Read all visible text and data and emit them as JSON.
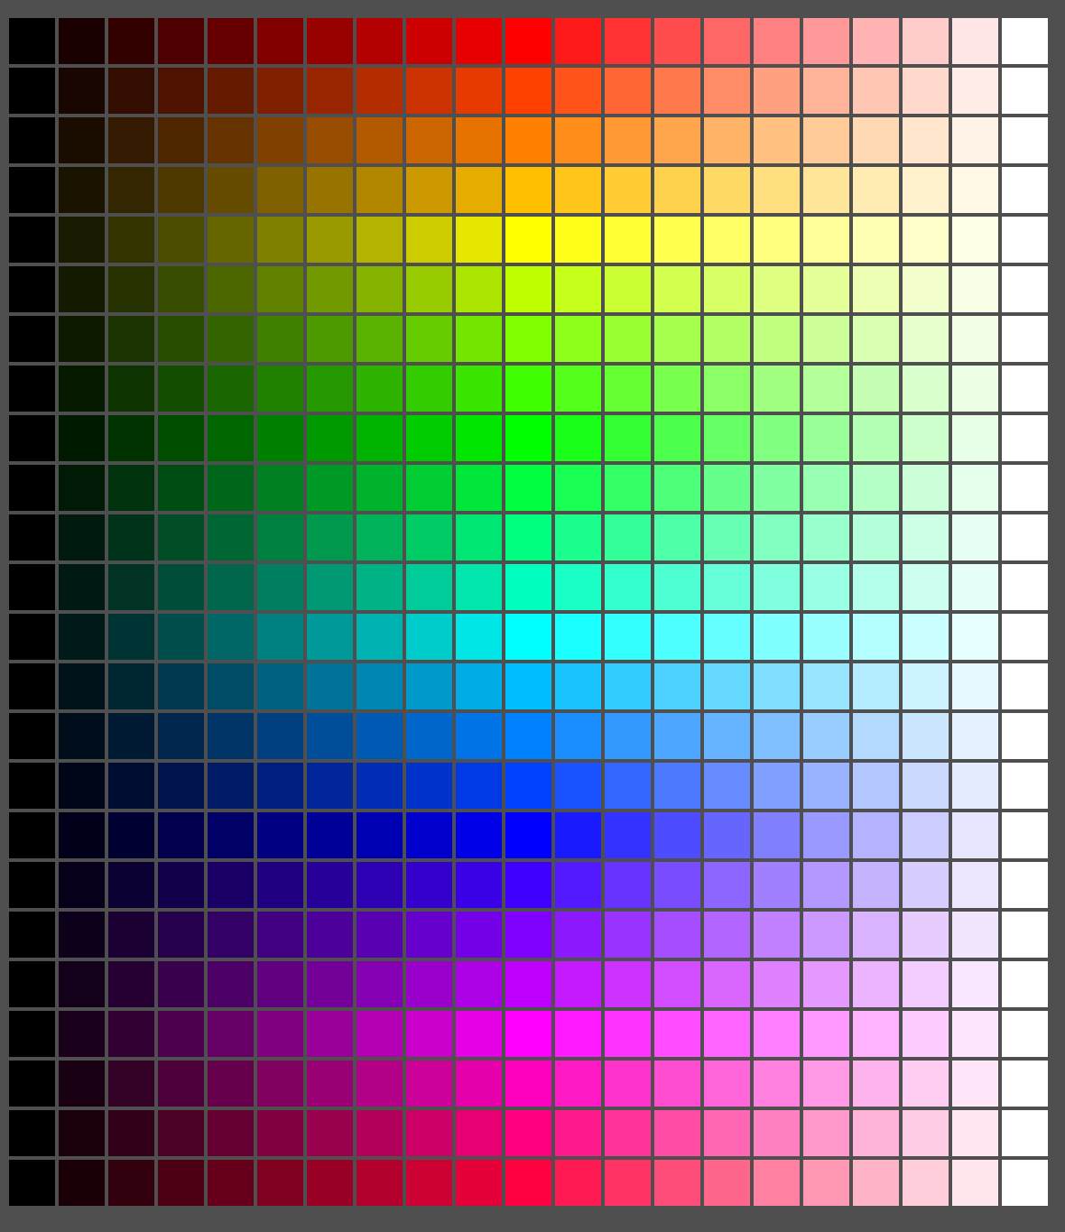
{
  "rows": [
    {
      "swatches": [
        {
          "color": "#000000"
        },
        {
          "color": "#1a0000"
        },
        {
          "color": "#330000"
        },
        {
          "color": "#4d0000"
        },
        {
          "color": "#660000"
        },
        {
          "color": "#800000"
        },
        {
          "color": "#990000"
        },
        {
          "color": "#b30000"
        },
        {
          "color": "#cc0000"
        },
        {
          "color": "#e60000"
        },
        {
          "color": "#ff0000"
        },
        {
          "color": "#ff1a1a"
        },
        {
          "color": "#ff3333"
        },
        {
          "color": "#ff4d4d"
        },
        {
          "color": "#ff6666"
        },
        {
          "color": "#ff8080"
        },
        {
          "color": "#ff9999"
        },
        {
          "color": "#ffb3b3"
        },
        {
          "color": "#ffcccc"
        },
        {
          "color": "#ffe6e6"
        },
        {
          "color": "#ffffff"
        }
      ]
    },
    {
      "swatches": [
        {
          "color": "#000000"
        },
        {
          "color": "#1a0600"
        },
        {
          "color": "#330d00"
        },
        {
          "color": "#4d1300"
        },
        {
          "color": "#661a00"
        },
        {
          "color": "#802000"
        },
        {
          "color": "#992600"
        },
        {
          "color": "#b32d00"
        },
        {
          "color": "#cc3300"
        },
        {
          "color": "#e63a00"
        },
        {
          "color": "#ff4000"
        },
        {
          "color": "#ff531a"
        },
        {
          "color": "#ff6633"
        },
        {
          "color": "#ff794d"
        },
        {
          "color": "#ff8c66"
        },
        {
          "color": "#ffa080"
        },
        {
          "color": "#ffb399"
        },
        {
          "color": "#ffc6b3"
        },
        {
          "color": "#ffd9cc"
        },
        {
          "color": "#ffece6"
        },
        {
          "color": "#ffffff"
        }
      ]
    },
    {
      "swatches": [
        {
          "color": "#000000"
        },
        {
          "color": "#1a0d00"
        },
        {
          "color": "#331a00"
        },
        {
          "color": "#4d2600"
        },
        {
          "color": "#663300"
        },
        {
          "color": "#804000"
        },
        {
          "color": "#994d00"
        },
        {
          "color": "#b35a00"
        },
        {
          "color": "#cc6600"
        },
        {
          "color": "#e67300"
        },
        {
          "color": "#ff8000"
        },
        {
          "color": "#ff8d1a"
        },
        {
          "color": "#ff9933"
        },
        {
          "color": "#ffa64d"
        },
        {
          "color": "#ffb366"
        },
        {
          "color": "#ffc080"
        },
        {
          "color": "#ffcc99"
        },
        {
          "color": "#ffd9b3"
        },
        {
          "color": "#ffe6cc"
        },
        {
          "color": "#fff2e6"
        },
        {
          "color": "#ffffff"
        }
      ]
    },
    {
      "swatches": [
        {
          "color": "#000000"
        },
        {
          "color": "#1a1300"
        },
        {
          "color": "#332600"
        },
        {
          "color": "#4d3900"
        },
        {
          "color": "#664c00"
        },
        {
          "color": "#806000"
        },
        {
          "color": "#997300"
        },
        {
          "color": "#b38600"
        },
        {
          "color": "#cc9900"
        },
        {
          "color": "#e6ac00"
        },
        {
          "color": "#ffbf00"
        },
        {
          "color": "#ffc51a"
        },
        {
          "color": "#ffcc33"
        },
        {
          "color": "#ffd24d"
        },
        {
          "color": "#ffd966"
        },
        {
          "color": "#ffdf80"
        },
        {
          "color": "#ffe599"
        },
        {
          "color": "#ffecb3"
        },
        {
          "color": "#fff2cc"
        },
        {
          "color": "#fff9e6"
        },
        {
          "color": "#ffffff"
        }
      ]
    },
    {
      "swatches": [
        {
          "color": "#000000"
        },
        {
          "color": "#1a1a00"
        },
        {
          "color": "#333300"
        },
        {
          "color": "#4d4d00"
        },
        {
          "color": "#666600"
        },
        {
          "color": "#808000"
        },
        {
          "color": "#999900"
        },
        {
          "color": "#b3b300"
        },
        {
          "color": "#cccc00"
        },
        {
          "color": "#e6e600"
        },
        {
          "color": "#ffff00"
        },
        {
          "color": "#ffff1a"
        },
        {
          "color": "#ffff33"
        },
        {
          "color": "#ffff4d"
        },
        {
          "color": "#ffff66"
        },
        {
          "color": "#ffff80"
        },
        {
          "color": "#ffff99"
        },
        {
          "color": "#ffffb3"
        },
        {
          "color": "#ffffcc"
        },
        {
          "color": "#ffffe6"
        },
        {
          "color": "#ffffff"
        }
      ]
    },
    {
      "swatches": [
        {
          "color": "#000000"
        },
        {
          "color": "#131a00"
        },
        {
          "color": "#263300"
        },
        {
          "color": "#394d00"
        },
        {
          "color": "#4c6600"
        },
        {
          "color": "#608000"
        },
        {
          "color": "#739900"
        },
        {
          "color": "#86b300"
        },
        {
          "color": "#99cc00"
        },
        {
          "color": "#ace600"
        },
        {
          "color": "#bfff00"
        },
        {
          "color": "#c5ff1a"
        },
        {
          "color": "#ccff33"
        },
        {
          "color": "#d2ff4d"
        },
        {
          "color": "#d9ff66"
        },
        {
          "color": "#dfff80"
        },
        {
          "color": "#e5ff99"
        },
        {
          "color": "#ecffb3"
        },
        {
          "color": "#f2ffcc"
        },
        {
          "color": "#f9ffe6"
        },
        {
          "color": "#ffffff"
        }
      ]
    },
    {
      "swatches": [
        {
          "color": "#000000"
        },
        {
          "color": "#0d1a00"
        },
        {
          "color": "#1a3300"
        },
        {
          "color": "#264d00"
        },
        {
          "color": "#336600"
        },
        {
          "color": "#408000"
        },
        {
          "color": "#4d9900"
        },
        {
          "color": "#5ab300"
        },
        {
          "color": "#66cc00"
        },
        {
          "color": "#73e600"
        },
        {
          "color": "#80ff00"
        },
        {
          "color": "#8dff1a"
        },
        {
          "color": "#99ff33"
        },
        {
          "color": "#a6ff4d"
        },
        {
          "color": "#b3ff66"
        },
        {
          "color": "#c0ff80"
        },
        {
          "color": "#ccff99"
        },
        {
          "color": "#d9ffb3"
        },
        {
          "color": "#e6ffcc"
        },
        {
          "color": "#f2ffe6"
        },
        {
          "color": "#ffffff"
        }
      ]
    },
    {
      "swatches": [
        {
          "color": "#000000"
        },
        {
          "color": "#061a00"
        },
        {
          "color": "#0d3300"
        },
        {
          "color": "#134d00"
        },
        {
          "color": "#1a6600"
        },
        {
          "color": "#208000"
        },
        {
          "color": "#269900"
        },
        {
          "color": "#2db300"
        },
        {
          "color": "#33cc00"
        },
        {
          "color": "#3ae600"
        },
        {
          "color": "#40ff00"
        },
        {
          "color": "#53ff1a"
        },
        {
          "color": "#66ff33"
        },
        {
          "color": "#79ff4d"
        },
        {
          "color": "#8cff66"
        },
        {
          "color": "#a0ff80"
        },
        {
          "color": "#b3ff99"
        },
        {
          "color": "#c6ffb3"
        },
        {
          "color": "#d9ffcc"
        },
        {
          "color": "#ecffe6"
        },
        {
          "color": "#ffffff"
        }
      ]
    },
    {
      "swatches": [
        {
          "color": "#000000"
        },
        {
          "color": "#001a00"
        },
        {
          "color": "#003300"
        },
        {
          "color": "#004d00"
        },
        {
          "color": "#006600"
        },
        {
          "color": "#008000"
        },
        {
          "color": "#009900"
        },
        {
          "color": "#00b300"
        },
        {
          "color": "#00cc00"
        },
        {
          "color": "#00e600"
        },
        {
          "color": "#00ff00"
        },
        {
          "color": "#1aff1a"
        },
        {
          "color": "#33ff33"
        },
        {
          "color": "#4dff4d"
        },
        {
          "color": "#66ff66"
        },
        {
          "color": "#80ff80"
        },
        {
          "color": "#99ff99"
        },
        {
          "color": "#b3ffb3"
        },
        {
          "color": "#ccffcc"
        },
        {
          "color": "#e6ffe6"
        },
        {
          "color": "#ffffff"
        }
      ]
    },
    {
      "swatches": [
        {
          "color": "#000000"
        },
        {
          "color": "#001a06"
        },
        {
          "color": "#00330d"
        },
        {
          "color": "#004d13"
        },
        {
          "color": "#00661a"
        },
        {
          "color": "#008020"
        },
        {
          "color": "#009926"
        },
        {
          "color": "#00b32d"
        },
        {
          "color": "#00cc33"
        },
        {
          "color": "#00e63a"
        },
        {
          "color": "#00ff40"
        },
        {
          "color": "#1aff53"
        },
        {
          "color": "#33ff66"
        },
        {
          "color": "#4dff79"
        },
        {
          "color": "#66ff8c"
        },
        {
          "color": "#80ffa0"
        },
        {
          "color": "#99ffb3"
        },
        {
          "color": "#b3ffc6"
        },
        {
          "color": "#ccffd9"
        },
        {
          "color": "#e6ffec"
        },
        {
          "color": "#ffffff"
        }
      ]
    },
    {
      "swatches": [
        {
          "color": "#000000"
        },
        {
          "color": "#001a0d"
        },
        {
          "color": "#00331a"
        },
        {
          "color": "#004d26"
        },
        {
          "color": "#006633"
        },
        {
          "color": "#008040"
        },
        {
          "color": "#00994d"
        },
        {
          "color": "#00b35a"
        },
        {
          "color": "#00cc66"
        },
        {
          "color": "#00e673"
        },
        {
          "color": "#00ff80"
        },
        {
          "color": "#1aff8d"
        },
        {
          "color": "#33ff99"
        },
        {
          "color": "#4dffa6"
        },
        {
          "color": "#66ffb3"
        },
        {
          "color": "#80ffc0"
        },
        {
          "color": "#99ffcc"
        },
        {
          "color": "#b3ffd9"
        },
        {
          "color": "#ccffe6"
        },
        {
          "color": "#e6fff2"
        },
        {
          "color": "#ffffff"
        }
      ]
    },
    {
      "swatches": [
        {
          "color": "#000000"
        },
        {
          "color": "#001a13"
        },
        {
          "color": "#003326"
        },
        {
          "color": "#004d39"
        },
        {
          "color": "#00664c"
        },
        {
          "color": "#008060"
        },
        {
          "color": "#009973"
        },
        {
          "color": "#00b386"
        },
        {
          "color": "#00cc99"
        },
        {
          "color": "#00e6ac"
        },
        {
          "color": "#00ffbf"
        },
        {
          "color": "#1affc5"
        },
        {
          "color": "#33ffcc"
        },
        {
          "color": "#4dffd2"
        },
        {
          "color": "#66ffd9"
        },
        {
          "color": "#80ffdf"
        },
        {
          "color": "#99ffe5"
        },
        {
          "color": "#b3ffec"
        },
        {
          "color": "#ccfff2"
        },
        {
          "color": "#e6fff9"
        },
        {
          "color": "#ffffff"
        }
      ]
    },
    {
      "swatches": [
        {
          "color": "#000000"
        },
        {
          "color": "#001a1a"
        },
        {
          "color": "#003333"
        },
        {
          "color": "#004d4d"
        },
        {
          "color": "#006666"
        },
        {
          "color": "#008080"
        },
        {
          "color": "#009999"
        },
        {
          "color": "#00b3b3"
        },
        {
          "color": "#00cccc"
        },
        {
          "color": "#00e6e6"
        },
        {
          "color": "#00ffff"
        },
        {
          "color": "#1affff"
        },
        {
          "color": "#33ffff"
        },
        {
          "color": "#4dffff"
        },
        {
          "color": "#66ffff"
        },
        {
          "color": "#80ffff"
        },
        {
          "color": "#99ffff"
        },
        {
          "color": "#b3ffff"
        },
        {
          "color": "#ccffff"
        },
        {
          "color": "#e6ffff"
        },
        {
          "color": "#ffffff"
        }
      ]
    },
    {
      "swatches": [
        {
          "color": "#000000"
        },
        {
          "color": "#00131a"
        },
        {
          "color": "#002633"
        },
        {
          "color": "#00394d"
        },
        {
          "color": "#004c66"
        },
        {
          "color": "#006080"
        },
        {
          "color": "#007399"
        },
        {
          "color": "#0086b3"
        },
        {
          "color": "#0099cc"
        },
        {
          "color": "#00ace6"
        },
        {
          "color": "#00bfff"
        },
        {
          "color": "#1ac5ff"
        },
        {
          "color": "#33ccff"
        },
        {
          "color": "#4dd2ff"
        },
        {
          "color": "#66d9ff"
        },
        {
          "color": "#80dfff"
        },
        {
          "color": "#99e5ff"
        },
        {
          "color": "#b3ecff"
        },
        {
          "color": "#ccf2ff"
        },
        {
          "color": "#e6f9ff"
        },
        {
          "color": "#ffffff"
        }
      ]
    },
    {
      "swatches": [
        {
          "color": "#000000"
        },
        {
          "color": "#000d1a"
        },
        {
          "color": "#001a33"
        },
        {
          "color": "#00264d"
        },
        {
          "color": "#003366"
        },
        {
          "color": "#004080"
        },
        {
          "color": "#004d99"
        },
        {
          "color": "#005ab3"
        },
        {
          "color": "#0066cc"
        },
        {
          "color": "#0073e6"
        },
        {
          "color": "#0080ff"
        },
        {
          "color": "#1a8dff"
        },
        {
          "color": "#3399ff"
        },
        {
          "color": "#4da6ff"
        },
        {
          "color": "#66b3ff"
        },
        {
          "color": "#80c0ff"
        },
        {
          "color": "#99ccff"
        },
        {
          "color": "#b3d9ff"
        },
        {
          "color": "#cce6ff"
        },
        {
          "color": "#e6f2ff"
        },
        {
          "color": "#ffffff"
        }
      ]
    },
    {
      "swatches": [
        {
          "color": "#000000"
        },
        {
          "color": "#00061a"
        },
        {
          "color": "#000d33"
        },
        {
          "color": "#00134d"
        },
        {
          "color": "#001a66"
        },
        {
          "color": "#002080"
        },
        {
          "color": "#002699"
        },
        {
          "color": "#002db3"
        },
        {
          "color": "#0033cc"
        },
        {
          "color": "#003ae6"
        },
        {
          "color": "#0040ff"
        },
        {
          "color": "#1a53ff"
        },
        {
          "color": "#3366ff"
        },
        {
          "color": "#4d79ff"
        },
        {
          "color": "#668cff"
        },
        {
          "color": "#80a0ff"
        },
        {
          "color": "#99b3ff"
        },
        {
          "color": "#b3c6ff"
        },
        {
          "color": "#ccd9ff"
        },
        {
          "color": "#e6ecff"
        },
        {
          "color": "#ffffff"
        }
      ]
    },
    {
      "swatches": [
        {
          "color": "#000000"
        },
        {
          "color": "#00001a"
        },
        {
          "color": "#000033"
        },
        {
          "color": "#00004d"
        },
        {
          "color": "#000066"
        },
        {
          "color": "#000080"
        },
        {
          "color": "#000099"
        },
        {
          "color": "#0000b3"
        },
        {
          "color": "#0000cc"
        },
        {
          "color": "#0000e6"
        },
        {
          "color": "#0000ff"
        },
        {
          "color": "#1a1aff"
        },
        {
          "color": "#3333ff"
        },
        {
          "color": "#4d4dff"
        },
        {
          "color": "#6666ff"
        },
        {
          "color": "#8080ff"
        },
        {
          "color": "#9999ff"
        },
        {
          "color": "#b3b3ff"
        },
        {
          "color": "#ccccff"
        },
        {
          "color": "#e6e6ff"
        },
        {
          "color": "#ffffff"
        }
      ]
    },
    {
      "swatches": [
        {
          "color": "#000000"
        },
        {
          "color": "#06001a"
        },
        {
          "color": "#0d0033"
        },
        {
          "color": "#13004d"
        },
        {
          "color": "#1a0066"
        },
        {
          "color": "#200080"
        },
        {
          "color": "#260099"
        },
        {
          "color": "#2d00b3"
        },
        {
          "color": "#3300cc"
        },
        {
          "color": "#3a00e6"
        },
        {
          "color": "#4000ff"
        },
        {
          "color": "#531aff"
        },
        {
          "color": "#6633ff"
        },
        {
          "color": "#794dff"
        },
        {
          "color": "#8c66ff"
        },
        {
          "color": "#a080ff"
        },
        {
          "color": "#b399ff"
        },
        {
          "color": "#c6b3ff"
        },
        {
          "color": "#d9ccff"
        },
        {
          "color": "#ece6ff"
        },
        {
          "color": "#ffffff"
        }
      ]
    },
    {
      "swatches": [
        {
          "color": "#000000"
        },
        {
          "color": "#0d001a"
        },
        {
          "color": "#1a0033"
        },
        {
          "color": "#26004d"
        },
        {
          "color": "#330066"
        },
        {
          "color": "#400080"
        },
        {
          "color": "#4d0099"
        },
        {
          "color": "#5a00b3"
        },
        {
          "color": "#6600cc"
        },
        {
          "color": "#7300e6"
        },
        {
          "color": "#8000ff"
        },
        {
          "color": "#8d1aff"
        },
        {
          "color": "#9933ff"
        },
        {
          "color": "#a64dff"
        },
        {
          "color": "#b366ff"
        },
        {
          "color": "#c080ff"
        },
        {
          "color": "#cc99ff"
        },
        {
          "color": "#d9b3ff"
        },
        {
          "color": "#e6ccff"
        },
        {
          "color": "#f2e6ff"
        },
        {
          "color": "#ffffff"
        }
      ]
    },
    {
      "swatches": [
        {
          "color": "#000000"
        },
        {
          "color": "#13001a"
        },
        {
          "color": "#260033"
        },
        {
          "color": "#39004d"
        },
        {
          "color": "#4c0066"
        },
        {
          "color": "#600080"
        },
        {
          "color": "#730099"
        },
        {
          "color": "#8600b3"
        },
        {
          "color": "#9900cc"
        },
        {
          "color": "#ac00e6"
        },
        {
          "color": "#bf00ff"
        },
        {
          "color": "#c51aff"
        },
        {
          "color": "#cc33ff"
        },
        {
          "color": "#d24dff"
        },
        {
          "color": "#d966ff"
        },
        {
          "color": "#df80ff"
        },
        {
          "color": "#e599ff"
        },
        {
          "color": "#ecb3ff"
        },
        {
          "color": "#f2ccff"
        },
        {
          "color": "#f9e6ff"
        },
        {
          "color": "#ffffff"
        }
      ]
    },
    {
      "swatches": [
        {
          "color": "#000000"
        },
        {
          "color": "#1a001a"
        },
        {
          "color": "#330033"
        },
        {
          "color": "#4d004d"
        },
        {
          "color": "#660066"
        },
        {
          "color": "#800080"
        },
        {
          "color": "#990099"
        },
        {
          "color": "#b300b3"
        },
        {
          "color": "#cc00cc"
        },
        {
          "color": "#e600e6"
        },
        {
          "color": "#ff00ff"
        },
        {
          "color": "#ff1aff"
        },
        {
          "color": "#ff33ff"
        },
        {
          "color": "#ff4dff"
        },
        {
          "color": "#ff66ff"
        },
        {
          "color": "#ff80ff"
        },
        {
          "color": "#ff99ff"
        },
        {
          "color": "#ffb3ff"
        },
        {
          "color": "#ffccff"
        },
        {
          "color": "#ffe6ff"
        },
        {
          "color": "#ffffff"
        }
      ]
    },
    {
      "swatches": [
        {
          "color": "#000000"
        },
        {
          "color": "#1a0013"
        },
        {
          "color": "#330026"
        },
        {
          "color": "#4d0039"
        },
        {
          "color": "#66004c"
        },
        {
          "color": "#800060"
        },
        {
          "color": "#990073"
        },
        {
          "color": "#b30086"
        },
        {
          "color": "#cc0099"
        },
        {
          "color": "#e600ac"
        },
        {
          "color": "#ff00bf"
        },
        {
          "color": "#ff1ac5"
        },
        {
          "color": "#ff33cc"
        },
        {
          "color": "#ff4dd2"
        },
        {
          "color": "#ff66d9"
        },
        {
          "color": "#ff80df"
        },
        {
          "color": "#ff99e5"
        },
        {
          "color": "#ffb3ec"
        },
        {
          "color": "#ffccf2"
        },
        {
          "color": "#ffe6f9"
        },
        {
          "color": "#ffffff"
        }
      ]
    },
    {
      "swatches": [
        {
          "color": "#000000"
        },
        {
          "color": "#1a000d"
        },
        {
          "color": "#33001a"
        },
        {
          "color": "#4d0026"
        },
        {
          "color": "#660033"
        },
        {
          "color": "#800040"
        },
        {
          "color": "#99004d"
        },
        {
          "color": "#b3005a"
        },
        {
          "color": "#cc0066"
        },
        {
          "color": "#e60073"
        },
        {
          "color": "#ff0080"
        },
        {
          "color": "#ff1a8d"
        },
        {
          "color": "#ff3399"
        },
        {
          "color": "#ff4da6"
        },
        {
          "color": "#ff66b3"
        },
        {
          "color": "#ff80c0"
        },
        {
          "color": "#ff99cc"
        },
        {
          "color": "#ffb3d9"
        },
        {
          "color": "#ffcce6"
        },
        {
          "color": "#ffe6f2"
        },
        {
          "color": "#ffffff"
        }
      ]
    },
    {
      "swatches": [
        {
          "color": "#000000"
        },
        {
          "color": "#1a0006"
        },
        {
          "color": "#33000d"
        },
        {
          "color": "#4d0013"
        },
        {
          "color": "#66001a"
        },
        {
          "color": "#800020"
        },
        {
          "color": "#990026"
        },
        {
          "color": "#b3002d"
        },
        {
          "color": "#cc0033"
        },
        {
          "color": "#e6003a"
        },
        {
          "color": "#ff0040"
        },
        {
          "color": "#ff1a53"
        },
        {
          "color": "#ff3366"
        },
        {
          "color": "#ff4d79"
        },
        {
          "color": "#ff668c"
        },
        {
          "color": "#ff80a0"
        },
        {
          "color": "#ff99b3"
        },
        {
          "color": "#ffb3c6"
        },
        {
          "color": "#ffccd9"
        },
        {
          "color": "#ffe6ec"
        },
        {
          "color": "#ffffff"
        }
      ]
    }
  ]
}
